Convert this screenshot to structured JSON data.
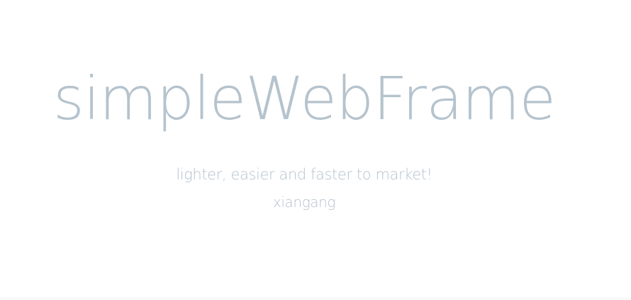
{
  "hero": {
    "title": "simpleWebFrame",
    "tagline": "lighter, easier and faster to market!",
    "author": "xiangang"
  },
  "colors": {
    "text": "#b5c3cd",
    "background": "#ffffff"
  }
}
